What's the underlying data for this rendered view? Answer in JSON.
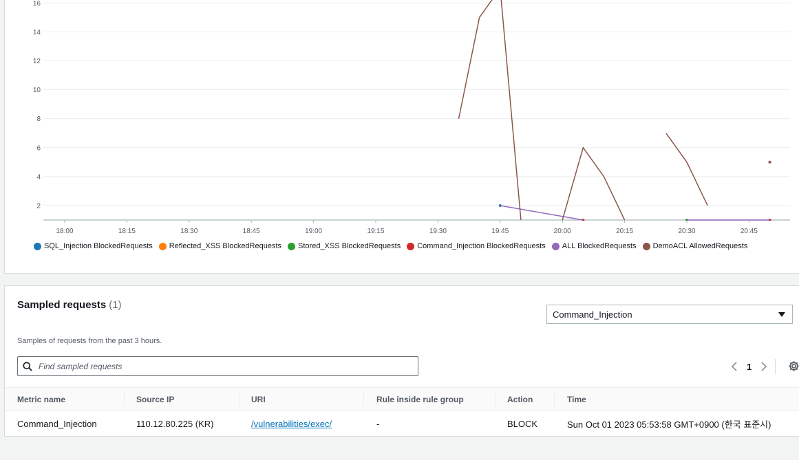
{
  "chart_data": {
    "type": "line",
    "x_ticks": [
      "18:00",
      "18:15",
      "18:30",
      "18:45",
      "19:00",
      "19:15",
      "19:30",
      "19:45",
      "20:00",
      "20:15",
      "20:30",
      "20:45"
    ],
    "y_ticks": [
      2,
      4,
      6,
      8,
      10,
      12,
      14,
      16
    ],
    "ylim": [
      1,
      16.8
    ],
    "grid": true,
    "legend_position": "bottom-left",
    "series": [
      {
        "name": "SQL_Injection BlockedRequests",
        "color": "#1f77b4",
        "segments": [
          [
            [
              "19:45",
              2
            ]
          ]
        ]
      },
      {
        "name": "Reflected_XSS BlockedRequests",
        "color": "#ff7f0e",
        "segments": []
      },
      {
        "name": "Stored_XSS BlockedRequests",
        "color": "#2ca02c",
        "segments": [
          [
            [
              "20:30",
              1
            ]
          ]
        ]
      },
      {
        "name": "Command_Injection BlockedRequests",
        "color": "#d62728",
        "segments": [
          [
            [
              "20:05",
              1
            ]
          ],
          [
            [
              "20:50",
              1
            ]
          ]
        ]
      },
      {
        "name": "ALL BlockedRequests",
        "color": "#9467bd",
        "segments": [
          [
            [
              "19:45",
              2
            ],
            [
              "20:05",
              1
            ]
          ],
          [
            [
              "20:30",
              1
            ],
            [
              "20:50",
              1
            ]
          ]
        ]
      },
      {
        "name": "DemoACL AllowedRequests",
        "color": "#8c564b",
        "segments": [
          [
            [
              "19:35",
              8
            ],
            [
              "19:40",
              15
            ],
            [
              "19:45",
              17
            ],
            [
              "19:50",
              1
            ]
          ],
          [
            [
              "20:00",
              1
            ],
            [
              "20:05",
              6
            ],
            [
              "20:10",
              4
            ],
            [
              "20:15",
              1
            ]
          ],
          [
            [
              "20:25",
              7
            ],
            [
              "20:30",
              5
            ],
            [
              "20:35",
              2
            ]
          ],
          [
            [
              "20:50",
              5
            ]
          ]
        ]
      }
    ]
  },
  "sampled": {
    "title": "Sampled requests",
    "count": "(1)",
    "description": "Samples of requests from the past 3 hours.",
    "rule_select": "Command_Injection",
    "search_placeholder": "Find sampled requests",
    "page": "1",
    "columns": [
      "Metric name",
      "Source IP",
      "URI",
      "Rule inside rule group",
      "Action",
      "Time"
    ],
    "rows": [
      [
        "Command_Injection",
        "110.12.80.225 (KR)",
        "/vulnerabilities/exec/",
        "-",
        "BLOCK",
        "Sun Oct 01 2023 05:53:58 GMT+0900 (한국 표준시)"
      ]
    ]
  },
  "icons": {
    "search": "search-icon",
    "caret": "caret-down-icon",
    "prev": "chevron-left-icon",
    "next": "chevron-right-icon",
    "settings": "gear-icon"
  }
}
